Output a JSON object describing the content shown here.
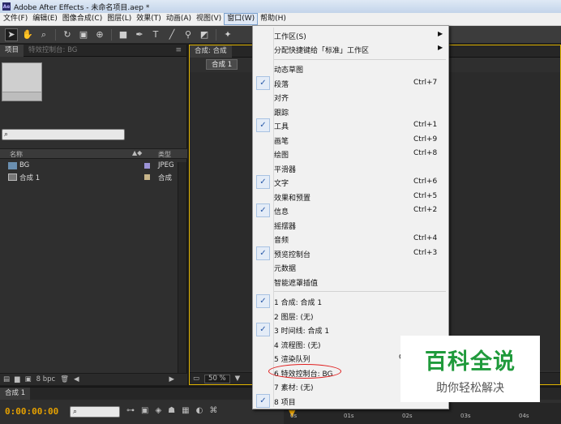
{
  "window": {
    "title": "Adobe After Effects - 未命名项目.aep *",
    "app_icon_text": "Ae"
  },
  "menubar": {
    "items": [
      "文件(F)",
      "编辑(E)",
      "图像合成(C)",
      "图层(L)",
      "效果(T)",
      "动画(A)",
      "视图(V)",
      "窗口(W)",
      "帮助(H)"
    ],
    "active_index": 7
  },
  "toolbar": {
    "tools": [
      "selection-tool-icon",
      "hand-tool-icon",
      "zoom-tool-icon",
      "rotate-tool-icon",
      "camera-tool-icon",
      "pan-behind-tool-icon",
      "rectangle-tool-icon",
      "pen-tool-icon",
      "text-tool-icon",
      "brush-tool-icon",
      "clone-stamp-tool-icon",
      "eraser-tool-icon",
      "puppet-tool-icon"
    ]
  },
  "project_panel": {
    "tab_project": "项目",
    "tab_effects": "特效控制台: BG",
    "col_name": "名称",
    "col_type": "类型",
    "items": [
      {
        "name": "BG",
        "type": "JPEG",
        "swatch": "#9b93d6"
      },
      {
        "name": "合成 1",
        "type": "合成",
        "swatch": "#c7b58a"
      }
    ],
    "bpc": "8 bpc"
  },
  "comp_panel": {
    "tab": "合成: 合成",
    "subtab": "合成 1",
    "zoom": "50 %"
  },
  "timeline": {
    "tab": "合成 1",
    "timecode": "0:00:00:00",
    "search_icon": "⌕",
    "ticks": [
      "0s",
      "01s",
      "02s",
      "03s",
      "04s"
    ]
  },
  "dropdown": {
    "items": [
      {
        "label": "工作区(S)",
        "submenu": true
      },
      {
        "label": "分配快捷键给「标准」工作区",
        "submenu": true
      },
      {
        "separator": true
      },
      {
        "label": "动态草图"
      },
      {
        "label": "段落",
        "checked": true,
        "shortcut": "Ctrl+7"
      },
      {
        "label": "对齐"
      },
      {
        "label": "跟踪"
      },
      {
        "label": "工具",
        "checked": true,
        "shortcut": "Ctrl+1"
      },
      {
        "label": "画笔",
        "shortcut": "Ctrl+9"
      },
      {
        "label": "绘图",
        "shortcut": "Ctrl+8"
      },
      {
        "label": "平滑器"
      },
      {
        "label": "文字",
        "checked": true,
        "shortcut": "Ctrl+6"
      },
      {
        "label": "效果和预置",
        "shortcut": "Ctrl+5"
      },
      {
        "label": "信息",
        "checked": true,
        "shortcut": "Ctrl+2"
      },
      {
        "label": "摇摆器"
      },
      {
        "label": "音频",
        "shortcut": "Ctrl+4"
      },
      {
        "label": "预览控制台",
        "checked": true,
        "shortcut": "Ctrl+3"
      },
      {
        "label": "元数据"
      },
      {
        "label": "智能遮罩插值"
      },
      {
        "separator": true
      },
      {
        "label": "1 合成: 合成 1",
        "checked": true
      },
      {
        "label": "2 图层: (无)"
      },
      {
        "label": "3 时间线: 合成 1",
        "checked": true
      },
      {
        "label": "4 流程图: (无)"
      },
      {
        "label": "5 渲染队列",
        "shortcut": "C"
      },
      {
        "label": "6 特效控制台: BG",
        "highlighted": true
      },
      {
        "label": "7 素材: (无)"
      },
      {
        "label": "8 项目",
        "checked": true
      }
    ]
  },
  "watermark": {
    "line1": "百科全说",
    "line2": "助你轻松解决"
  }
}
